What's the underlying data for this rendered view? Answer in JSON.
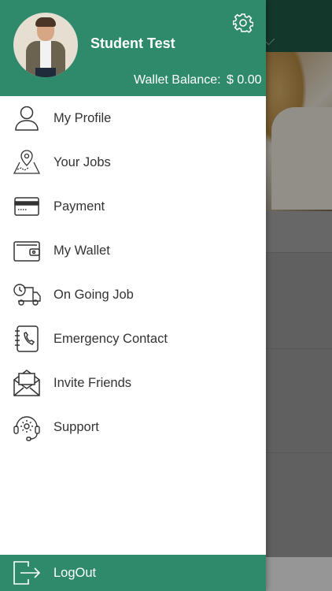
{
  "colors": {
    "primary": "#2e8a6b",
    "text": "#333333",
    "header_bg_app": "#1f5a45"
  },
  "profile": {
    "name": "Student Test",
    "wallet_label": "Wallet Balance:",
    "wallet_value": "$ 0.00"
  },
  "menu": {
    "items": [
      {
        "label": "My Profile",
        "icon": "user-icon"
      },
      {
        "label": "Your Jobs",
        "icon": "map-pin-icon"
      },
      {
        "label": "Payment",
        "icon": "credit-card-icon"
      },
      {
        "label": "My Wallet",
        "icon": "wallet-icon"
      },
      {
        "label": "On Going Job",
        "icon": "delivery-truck-icon"
      },
      {
        "label": "Emergency Contact",
        "icon": "phone-book-icon"
      },
      {
        "label": "Invite Friends",
        "icon": "envelope-icon"
      },
      {
        "label": "Support",
        "icon": "headset-gear-icon"
      }
    ]
  },
  "logout": {
    "label": "LogOut",
    "icon": "logout-icon"
  }
}
